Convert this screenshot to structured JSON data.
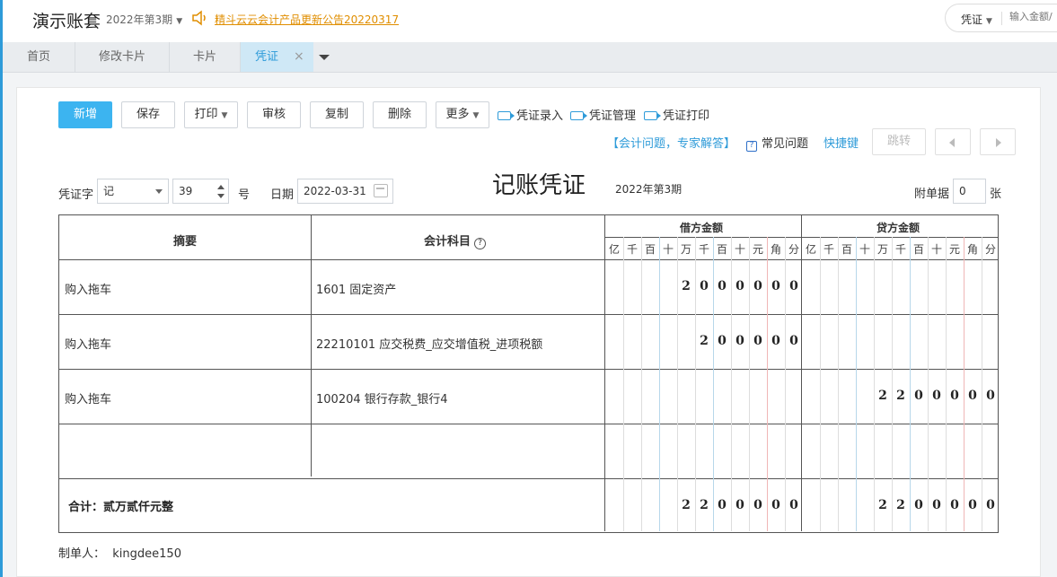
{
  "header": {
    "app_title": "演示账套",
    "period": "2022年第3期",
    "notice": "精斗云云会计产品更新公告20220317",
    "search_type": "凭证",
    "search_placeholder": "输入金额/"
  },
  "tabs": [
    {
      "label": "首页"
    },
    {
      "label": "修改卡片"
    },
    {
      "label": "卡片"
    },
    {
      "label": "凭证",
      "active": true
    }
  ],
  "toolbar": {
    "new": "新增",
    "save": "保存",
    "print": "打印",
    "audit": "审核",
    "copy": "复制",
    "delete": "删除",
    "more": "更多",
    "voucher_entry": "凭证录入",
    "voucher_manage": "凭证管理",
    "voucher_print": "凭证打印",
    "expert_help": "【会计问题，专家解答】",
    "faq": "常见问题",
    "shortcut": "快捷键",
    "jump": "跳转"
  },
  "voucher": {
    "word_label": "凭证字",
    "word_value": "记",
    "number_value": "39",
    "number_suffix": "号",
    "date_label": "日期",
    "date_value": "2022-03-31",
    "title": "记账凭证",
    "period": "2022年第3期",
    "attach_label": "附单据",
    "attach_value": "0",
    "attach_unit": "张",
    "maker_label": "制单人：",
    "maker_value": "kingdee150"
  },
  "table": {
    "col_summary": "摘要",
    "col_account": "会计科目",
    "col_debit": "借方金额",
    "col_credit": "贷方金额",
    "units": [
      "亿",
      "千",
      "百",
      "十",
      "万",
      "千",
      "百",
      "十",
      "元",
      "角",
      "分"
    ],
    "rows": [
      {
        "summary": "购入拖车",
        "account": "1601 固定资产",
        "debit": "2000000",
        "credit": ""
      },
      {
        "summary": "购入拖车",
        "account": "22210101 应交税费_应交增值税_进项税额",
        "debit": "200000",
        "credit": ""
      },
      {
        "summary": "购入拖车",
        "account": "100204 银行存款_银行4",
        "debit": "",
        "credit": "2200000"
      },
      {
        "summary": "",
        "account": "",
        "debit": "",
        "credit": ""
      }
    ],
    "total_label": "合计：贰万贰仟元整",
    "total_debit": "2200000",
    "total_credit": "2200000"
  },
  "colors": {
    "accent": "#2e9bd9",
    "primary_button": "#3cb4f0",
    "notice": "#e08e00"
  }
}
